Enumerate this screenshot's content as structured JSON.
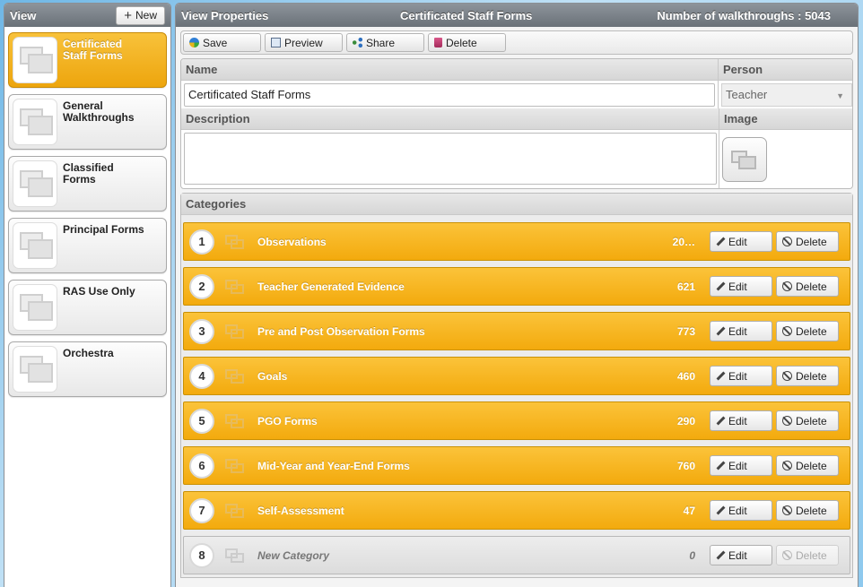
{
  "left_panel": {
    "title": "View",
    "new_label": "New",
    "items": [
      {
        "label": "Certificated Staff Forms",
        "active": true
      },
      {
        "label": "General Walkthroughs",
        "active": false
      },
      {
        "label": "Classified Forms",
        "active": false
      },
      {
        "label": "Principal Forms",
        "active": false
      },
      {
        "label": "RAS Use Only",
        "active": false
      },
      {
        "label": "Orchestra",
        "active": false
      }
    ]
  },
  "right_panel": {
    "title": "View Properties",
    "view_name": "Certificated Staff Forms",
    "walkthroughs_label": "Number of walkthroughs : 5043"
  },
  "toolbar": {
    "save_label": "Save",
    "preview_label": "Preview",
    "share_label": "Share",
    "delete_label": "Delete"
  },
  "form": {
    "name_header": "Name",
    "name_value": "Certificated Staff Forms",
    "person_header": "Person",
    "person_value": "Teacher",
    "description_header": "Description",
    "description_value": "",
    "image_header": "Image"
  },
  "categories": {
    "header": "Categories",
    "edit_label": "Edit",
    "delete_label": "Delete",
    "items": [
      {
        "num": "1",
        "name": "Observations",
        "count": "20…",
        "new": false
      },
      {
        "num": "2",
        "name": "Teacher Generated Evidence",
        "count": "621",
        "new": false
      },
      {
        "num": "3",
        "name": "Pre and Post Observation Forms",
        "count": "773",
        "new": false
      },
      {
        "num": "4",
        "name": "Goals",
        "count": "460",
        "new": false
      },
      {
        "num": "5",
        "name": "PGO Forms",
        "count": "290",
        "new": false
      },
      {
        "num": "6",
        "name": "Mid-Year and Year-End Forms",
        "count": "760",
        "new": false
      },
      {
        "num": "7",
        "name": "Self-Assessment",
        "count": "47",
        "new": false
      },
      {
        "num": "8",
        "name": "New Category",
        "count": "0",
        "new": true
      }
    ]
  },
  "colors": {
    "accent": "#f3aa0d",
    "header_bg": "#6a7178"
  }
}
